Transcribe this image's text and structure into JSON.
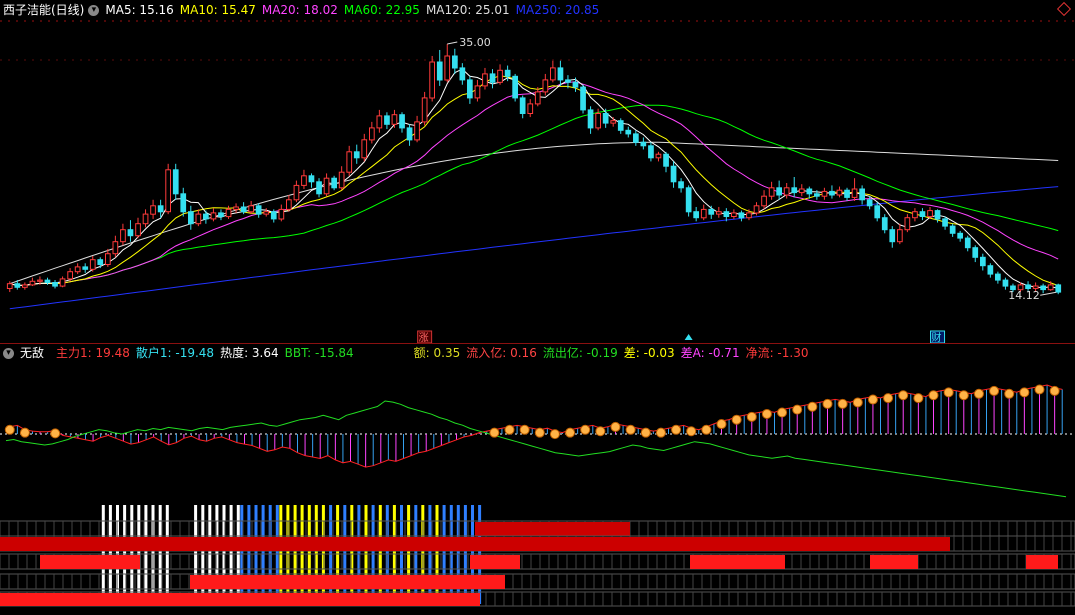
{
  "colors": {
    "up": "#ff3b3b",
    "down": "#35e0f0",
    "ma5": "#ffffff",
    "ma10": "#ffff00",
    "ma20": "#ff44ff",
    "ma60": "#00ff00",
    "ma120": "#dddddd",
    "ma250": "#2233ff",
    "main": "#ff3b3b",
    "retail": "#35e0f0",
    "heat": "#ffffff",
    "bbt": "#22dd22",
    "amount": "#dddd22",
    "inflow": "#ff4444",
    "outflow": "#22dd22",
    "diff": "#ffff00",
    "diffA": "#ff44ff",
    "net": "#ff3b3b"
  },
  "top_bar": {
    "title": "西子洁能(日线)",
    "ma5": "MA5: 15.16",
    "ma10": "MA10: 15.47",
    "ma20": "MA20: 18.02",
    "ma60": "MA60: 22.95",
    "ma120": "MA120: 25.01",
    "ma250": "MA250: 20.85"
  },
  "chart_labels": {
    "high_price": "35.00",
    "low_price": "14.12",
    "event_zhang": "涨",
    "event_cai": "财"
  },
  "indicator_bar": {
    "name": "无敌",
    "main_force": "主力1: 19.48",
    "retail": "散户1: -19.48",
    "heat": "热度: 3.64",
    "bbt": "BBT: -15.84",
    "amount": "额: 0.35",
    "inflow": "流入亿: 0.16",
    "outflow": "流出亿: -0.19",
    "diff": "差: -0.03",
    "diffA": "差A: -0.71",
    "net": "净流: -1.30"
  },
  "chart_data": {
    "type": "candlestick",
    "symbol": "西子洁能",
    "period": "日线",
    "price_high_marked": 35.0,
    "price_low_marked": 14.12,
    "candles": [
      [
        14.6,
        15.0,
        14.3,
        15.2
      ],
      [
        15.0,
        14.7,
        14.5,
        15.3
      ],
      [
        14.7,
        14.9,
        14.5,
        15.1
      ],
      [
        14.9,
        15.2,
        14.8,
        15.5
      ],
      [
        15.2,
        15.3,
        14.9,
        15.6
      ],
      [
        15.3,
        15.1,
        14.9,
        15.5
      ],
      [
        15.1,
        14.8,
        14.6,
        15.3
      ],
      [
        14.8,
        15.4,
        14.7,
        15.6
      ],
      [
        15.4,
        16.0,
        15.2,
        16.3
      ],
      [
        16.0,
        16.4,
        15.8,
        16.7
      ],
      [
        16.4,
        16.2,
        15.9,
        16.7
      ],
      [
        16.2,
        17.0,
        16.0,
        17.3
      ],
      [
        17.0,
        16.6,
        16.3,
        17.2
      ],
      [
        16.6,
        17.5,
        16.4,
        17.9
      ],
      [
        17.5,
        18.5,
        17.2,
        19.0
      ],
      [
        18.5,
        19.5,
        18.2,
        20.0
      ],
      [
        19.5,
        19.0,
        18.5,
        20.3
      ],
      [
        19.0,
        20.0,
        18.8,
        20.5
      ],
      [
        20.0,
        20.8,
        19.7,
        21.2
      ],
      [
        20.8,
        21.5,
        20.4,
        22.0
      ],
      [
        21.5,
        21.0,
        20.5,
        22.0
      ],
      [
        21.0,
        24.5,
        20.8,
        25.0
      ],
      [
        24.5,
        22.5,
        22.0,
        25.0
      ],
      [
        22.5,
        21.0,
        20.6,
        23.0
      ],
      [
        21.0,
        20.0,
        19.5,
        21.5
      ],
      [
        20.0,
        20.8,
        19.8,
        21.2
      ],
      [
        20.8,
        20.4,
        20.0,
        21.1
      ],
      [
        20.4,
        20.9,
        20.2,
        21.3
      ],
      [
        20.9,
        20.6,
        20.3,
        21.2
      ],
      [
        20.6,
        21.2,
        20.4,
        21.5
      ],
      [
        21.2,
        21.4,
        20.9,
        21.7
      ],
      [
        21.4,
        21.0,
        20.8,
        21.8
      ],
      [
        21.0,
        21.5,
        20.8,
        21.9
      ],
      [
        21.5,
        20.8,
        20.5,
        21.7
      ],
      [
        20.8,
        21.0,
        20.6,
        21.3
      ],
      [
        21.0,
        20.4,
        20.1,
        21.2
      ],
      [
        20.4,
        21.2,
        20.2,
        21.6
      ],
      [
        21.2,
        22.0,
        21.0,
        22.4
      ],
      [
        22.0,
        23.2,
        21.8,
        23.6
      ],
      [
        23.2,
        24.0,
        22.9,
        24.5
      ],
      [
        24.0,
        23.5,
        23.0,
        24.2
      ],
      [
        23.5,
        22.5,
        22.2,
        23.8
      ],
      [
        22.5,
        23.8,
        22.3,
        24.2
      ],
      [
        23.8,
        23.0,
        22.8,
        24.0
      ],
      [
        23.0,
        24.3,
        22.8,
        24.8
      ],
      [
        24.3,
        26.0,
        24.0,
        26.5
      ],
      [
        26.0,
        25.5,
        25.0,
        26.6
      ],
      [
        25.5,
        27.0,
        25.2,
        27.5
      ],
      [
        27.0,
        28.0,
        26.7,
        28.5
      ],
      [
        28.0,
        29.0,
        27.6,
        29.5
      ],
      [
        29.0,
        28.3,
        27.9,
        29.3
      ],
      [
        28.3,
        29.1,
        28.0,
        29.5
      ],
      [
        29.1,
        28.0,
        27.6,
        29.3
      ],
      [
        28.0,
        27.0,
        26.5,
        28.3
      ],
      [
        27.0,
        28.5,
        26.8,
        29.0
      ],
      [
        28.5,
        30.5,
        28.2,
        31.0
      ],
      [
        30.5,
        33.5,
        30.2,
        34.0
      ],
      [
        33.5,
        32.0,
        31.5,
        34.5
      ],
      [
        32.0,
        34.0,
        31.8,
        35.0
      ],
      [
        34.0,
        33.0,
        32.5,
        34.6
      ],
      [
        33.0,
        32.0,
        31.6,
        33.4
      ],
      [
        32.0,
        30.5,
        30.0,
        32.3
      ],
      [
        30.5,
        31.5,
        30.2,
        32.0
      ],
      [
        31.5,
        32.5,
        31.2,
        33.0
      ],
      [
        32.5,
        31.8,
        31.3,
        32.9
      ],
      [
        31.8,
        32.8,
        31.6,
        33.3
      ],
      [
        32.8,
        32.3,
        31.9,
        33.2
      ],
      [
        32.3,
        30.5,
        30.2,
        32.5
      ],
      [
        30.5,
        29.2,
        28.8,
        30.7
      ],
      [
        29.2,
        30.0,
        28.9,
        30.4
      ],
      [
        30.0,
        31.0,
        29.8,
        31.4
      ],
      [
        31.0,
        32.0,
        30.7,
        32.5
      ],
      [
        32.0,
        33.0,
        31.8,
        33.6
      ],
      [
        33.0,
        32.0,
        31.5,
        33.6
      ],
      [
        32.0,
        31.8,
        31.3,
        32.4
      ],
      [
        31.8,
        31.4,
        31.0,
        32.2
      ],
      [
        31.4,
        29.5,
        29.2,
        31.6
      ],
      [
        29.5,
        28.0,
        27.5,
        29.8
      ],
      [
        28.0,
        29.2,
        27.8,
        29.6
      ],
      [
        29.2,
        28.4,
        28.0,
        29.6
      ],
      [
        28.4,
        28.6,
        28.1,
        28.9
      ],
      [
        28.6,
        27.8,
        27.5,
        28.8
      ],
      [
        27.8,
        27.5,
        27.2,
        28.1
      ],
      [
        27.5,
        26.8,
        26.5,
        27.8
      ],
      [
        26.8,
        26.5,
        26.2,
        27.2
      ],
      [
        26.5,
        25.5,
        25.2,
        26.8
      ],
      [
        25.5,
        25.8,
        25.2,
        26.0
      ],
      [
        25.8,
        24.8,
        24.3,
        26.0
      ],
      [
        24.8,
        23.5,
        23.0,
        25.2
      ],
      [
        23.5,
        23.0,
        22.6,
        23.8
      ],
      [
        23.0,
        21.0,
        20.6,
        23.2
      ],
      [
        21.0,
        20.5,
        20.2,
        21.4
      ],
      [
        20.5,
        21.2,
        20.3,
        21.6
      ],
      [
        21.2,
        20.8,
        20.4,
        21.5
      ],
      [
        20.8,
        21.0,
        20.5,
        21.4
      ],
      [
        21.0,
        20.6,
        20.2,
        21.3
      ],
      [
        20.6,
        20.9,
        20.4,
        21.2
      ],
      [
        20.9,
        20.5,
        20.2,
        21.1
      ],
      [
        20.5,
        20.9,
        20.3,
        21.2
      ],
      [
        20.9,
        21.5,
        20.7,
        21.8
      ],
      [
        21.5,
        22.3,
        21.2,
        22.8
      ],
      [
        22.3,
        23.0,
        22.0,
        23.5
      ],
      [
        23.0,
        22.4,
        22.0,
        23.6
      ],
      [
        22.4,
        23.0,
        22.1,
        23.4
      ],
      [
        23.0,
        22.6,
        22.2,
        23.9
      ],
      [
        22.6,
        22.9,
        22.3,
        23.3
      ],
      [
        22.9,
        22.5,
        22.1,
        23.1
      ],
      [
        22.5,
        22.3,
        22.0,
        22.8
      ],
      [
        22.3,
        22.7,
        22.0,
        23.0
      ],
      [
        22.7,
        22.4,
        22.1,
        23.2
      ],
      [
        22.4,
        22.8,
        22.2,
        23.1
      ],
      [
        22.8,
        22.2,
        21.9,
        23.0
      ],
      [
        22.2,
        22.9,
        21.9,
        23.8
      ],
      [
        22.9,
        22.0,
        21.6,
        23.2
      ],
      [
        22.0,
        21.5,
        21.2,
        22.3
      ],
      [
        21.5,
        20.5,
        20.2,
        21.8
      ],
      [
        20.5,
        19.5,
        19.2,
        20.8
      ],
      [
        19.5,
        18.5,
        18.0,
        19.8
      ],
      [
        18.5,
        19.5,
        18.3,
        20.0
      ],
      [
        19.5,
        20.5,
        19.3,
        20.8
      ],
      [
        20.5,
        21.0,
        20.2,
        21.3
      ],
      [
        21.0,
        20.6,
        20.3,
        21.3
      ],
      [
        20.6,
        21.1,
        20.4,
        21.4
      ],
      [
        21.1,
        20.4,
        20.1,
        21.2
      ],
      [
        20.4,
        19.8,
        19.5,
        20.6
      ],
      [
        19.8,
        19.2,
        18.9,
        20.0
      ],
      [
        19.2,
        18.8,
        18.5,
        19.4
      ],
      [
        18.8,
        18.0,
        17.7,
        19.0
      ],
      [
        18.0,
        17.2,
        16.8,
        18.2
      ],
      [
        17.2,
        16.5,
        16.1,
        17.5
      ],
      [
        16.5,
        15.8,
        15.5,
        16.7
      ],
      [
        15.8,
        15.3,
        15.0,
        16.0
      ],
      [
        15.3,
        14.8,
        14.5,
        15.5
      ],
      [
        14.8,
        14.5,
        14.3,
        15.0
      ],
      [
        14.5,
        14.9,
        14.3,
        15.1
      ],
      [
        14.9,
        14.6,
        14.4,
        15.2
      ],
      [
        14.6,
        14.8,
        14.3,
        15.1
      ],
      [
        14.8,
        14.5,
        14.2,
        15.0
      ],
      [
        14.5,
        14.9,
        14.4,
        15.2
      ],
      [
        14.9,
        14.3,
        14.12,
        15.0
      ]
    ],
    "moving_averages": {
      "MA5": 15.16,
      "MA10": 15.47,
      "MA20": 18.02,
      "MA60": 22.95,
      "MA120": 25.01,
      "MA250": 20.85
    },
    "indicator": {
      "name": "无敌",
      "主力1": 19.48,
      "散户1": -19.48,
      "热度": 3.64,
      "BBT": -15.84,
      "额": 0.35,
      "流入亿": 0.16,
      "流出亿": -0.19,
      "差": -0.03,
      "差A": -0.71,
      "净流": -1.3
    },
    "indicator_series": {
      "main_force": [
        10,
        12,
        6,
        4,
        3,
        3,
        5,
        -2,
        -4,
        -6,
        -8,
        -10,
        -5,
        -2,
        -6,
        -10,
        -14,
        -12,
        -8,
        -4,
        -10,
        -15,
        -12,
        -6,
        -3,
        -8,
        -10,
        -6,
        -4,
        -8,
        -12,
        -14,
        -16,
        -20,
        -24,
        -22,
        -18,
        -20,
        -26,
        -30,
        -32,
        -34,
        -30,
        -36,
        -40,
        -38,
        -42,
        -46,
        -44,
        -40,
        -36,
        -38,
        -34,
        -30,
        -26,
        -24,
        -20,
        -16,
        -12,
        -8,
        -4,
        -2,
        2,
        4,
        6,
        8,
        10,
        12,
        10,
        8,
        6,
        8,
        4,
        2,
        6,
        8,
        10,
        12,
        8,
        10,
        14,
        12,
        10,
        8,
        6,
        4,
        6,
        8,
        10,
        12,
        8,
        6,
        10,
        14,
        18,
        20,
        24,
        26,
        28,
        30,
        32,
        30,
        34,
        36,
        38,
        40,
        42,
        44,
        46,
        48,
        46,
        44,
        48,
        50,
        52,
        50,
        54,
        56,
        58,
        56,
        54,
        52,
        58,
        60,
        62,
        60,
        58,
        56,
        60,
        62,
        64,
        62,
        60,
        58,
        62,
        64,
        66,
        68,
        64,
        62
      ],
      "green_line": [
        -12,
        -10,
        -14,
        -16,
        -18,
        -20,
        -18,
        -14,
        -10,
        -4,
        0,
        4,
        8,
        6,
        2,
        0,
        4,
        8,
        6,
        10,
        8,
        12,
        10,
        8,
        6,
        10,
        12,
        10,
        8,
        12,
        14,
        16,
        18,
        20,
        16,
        14,
        18,
        22,
        26,
        28,
        30,
        34,
        30,
        26,
        34,
        38,
        42,
        46,
        50,
        60,
        58,
        54,
        48,
        44,
        40,
        36,
        30,
        26,
        20,
        16,
        10,
        6,
        2,
        -2,
        -6,
        -10,
        -14,
        -18,
        -22,
        -26,
        -30,
        -34,
        -36,
        -38,
        -40,
        -38,
        -36,
        -34,
        -32,
        -28,
        -24,
        -20,
        -22,
        -26,
        -28,
        -30,
        -26,
        -22,
        -18,
        -14,
        -16,
        -18,
        -22,
        -26,
        -30,
        -34,
        -38,
        -40,
        -42,
        -44,
        -42,
        -40,
        -44,
        -46,
        -48,
        -50,
        -52,
        -54,
        -56,
        -58,
        -60,
        -62,
        -64,
        -66,
        -68,
        -70,
        -72,
        -74,
        -76,
        -78,
        -80,
        -82,
        -84,
        -86,
        -88,
        -90,
        -92,
        -94,
        -96,
        -98,
        -100,
        -102,
        -104,
        -106,
        -108,
        -110,
        -112,
        -114
      ]
    }
  }
}
